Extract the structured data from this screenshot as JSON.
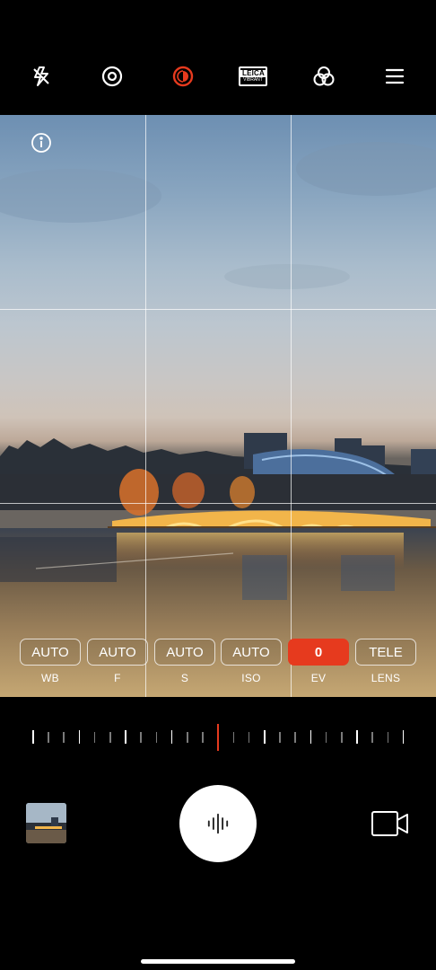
{
  "toolbar": {
    "icons": [
      "flash-off-icon",
      "lens-icon",
      "mode-icon",
      "leica-badge-icon",
      "filter-icon",
      "menu-icon"
    ],
    "leica": {
      "brand": "LEICA",
      "style": "VIBRANT"
    },
    "accent_color": "#e63a1e"
  },
  "pro_settings": [
    {
      "value": "AUTO",
      "label": "WB"
    },
    {
      "value": "AUTO",
      "label": "F"
    },
    {
      "value": "AUTO",
      "label": "S"
    },
    {
      "value": "AUTO",
      "label": "ISO"
    },
    {
      "value": "0",
      "label": "EV",
      "active": true
    },
    {
      "value": "TELE",
      "label": "LENS"
    }
  ],
  "slider": {
    "selected_level": 0
  },
  "controls": {
    "shutter_icon": "waveform-icon",
    "video_icon": "video-camera-icon",
    "gallery_icon": "gallery-thumbnail"
  }
}
